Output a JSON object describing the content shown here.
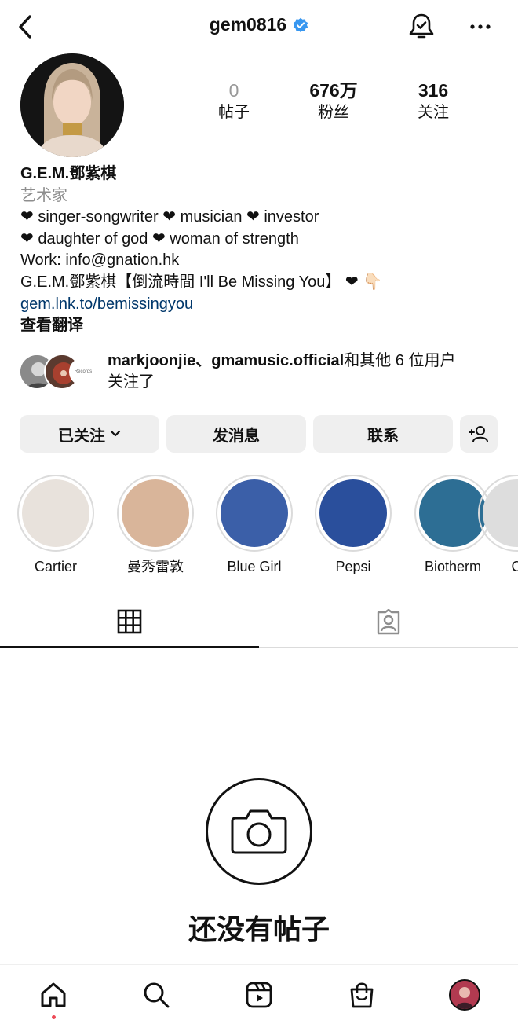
{
  "header": {
    "username": "gem0816",
    "verified": true
  },
  "profile": {
    "stats": [
      {
        "value": "0",
        "label": "帖子"
      },
      {
        "value": "676万",
        "label": "粉丝"
      },
      {
        "value": "316",
        "label": "关注"
      }
    ],
    "name": "G.E.M.鄧紫棋",
    "category": "艺术家",
    "bio_lines": [
      "❤ singer-songwriter ❤ musician ❤ investor",
      "❤ daughter of god ❤ woman of strength",
      "Work: info@gnation.hk",
      "G.E.M.鄧紫棋【倒流時間 I'll Be Missing You】 ❤ 👇🏻"
    ],
    "link": "gem.lnk.to/bemissingyou",
    "translate": "查看翻译"
  },
  "followed_by": {
    "names": "markjoonjie、gmamusic.official",
    "suffix": "和其他 6 位用户",
    "line2": "关注了",
    "badge_text": "Records"
  },
  "actions": {
    "following": "已关注",
    "message": "发消息",
    "contact": "联系"
  },
  "highlights": [
    {
      "label": "Cartier",
      "color": "#e8e2dc"
    },
    {
      "label": "曼秀雷敦",
      "color": "#d9b59a"
    },
    {
      "label": "Blue Girl",
      "color": "#3b5fa8"
    },
    {
      "label": "Pepsi",
      "color": "#2a4f9c"
    },
    {
      "label": "Biotherm",
      "color": "#2d6e94"
    },
    {
      "label": "C",
      "color": "#dddddd"
    }
  ],
  "empty_state": {
    "title": "还没有帖子"
  },
  "colors": {
    "link": "#00376b",
    "button_bg": "#efefef",
    "notification_dot": "#ed4956"
  },
  "icons": {
    "back": "chevron-left-icon",
    "bell": "bell-check-icon",
    "more": "more-horizontal-icon",
    "grid": "grid-icon",
    "tagged": "tagged-person-icon",
    "camera": "camera-icon",
    "nav": [
      "home-icon",
      "search-icon",
      "reels-icon",
      "shop-bag-icon",
      "profile-avatar"
    ]
  }
}
